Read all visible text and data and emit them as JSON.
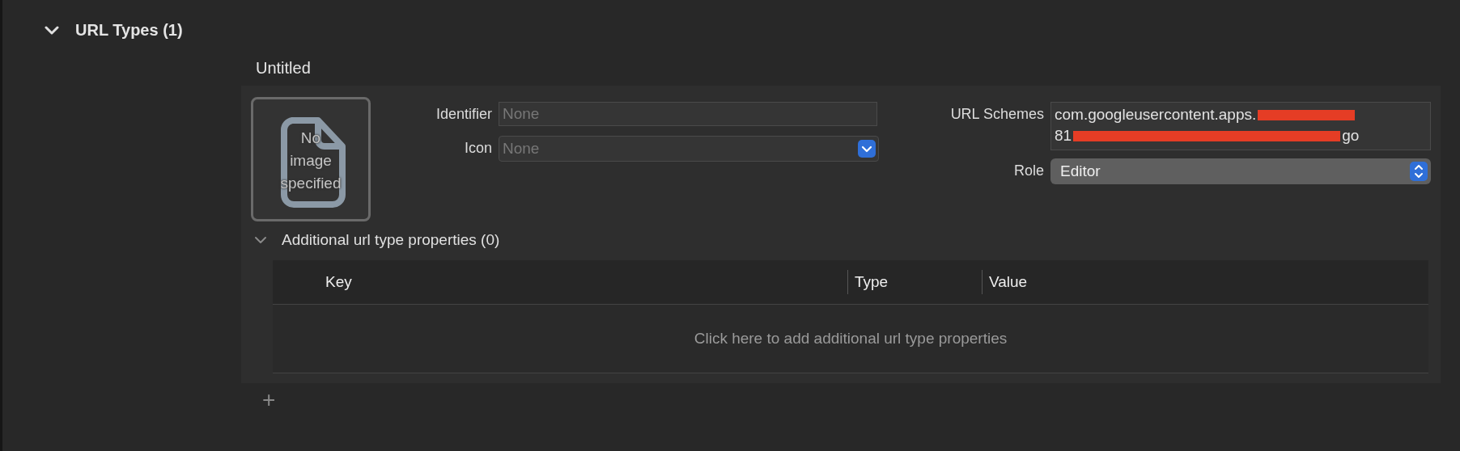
{
  "section": {
    "title": "URL Types (1)",
    "expanded": true
  },
  "url_type": {
    "name": "Untitled",
    "image_placeholder": "No image specified",
    "identifier": {
      "label": "Identifier",
      "placeholder": "None"
    },
    "icon": {
      "label": "Icon",
      "placeholder": "None"
    },
    "url_schemes": {
      "label": "URL Schemes",
      "segments": [
        {
          "kind": "text",
          "text": "com.googleusercontent.apps."
        },
        {
          "kind": "redaction"
        },
        {
          "kind": "break"
        },
        {
          "kind": "text",
          "text": "81"
        },
        {
          "kind": "redaction"
        },
        {
          "kind": "text",
          "text": "go"
        }
      ]
    },
    "role": {
      "label": "Role",
      "value": "Editor"
    },
    "additional": {
      "title": "Additional url type properties (0)",
      "expanded": true,
      "columns": [
        "Key",
        "Type",
        "Value"
      ],
      "empty_hint": "Click here to add additional url type properties"
    }
  },
  "add_button": "+"
}
